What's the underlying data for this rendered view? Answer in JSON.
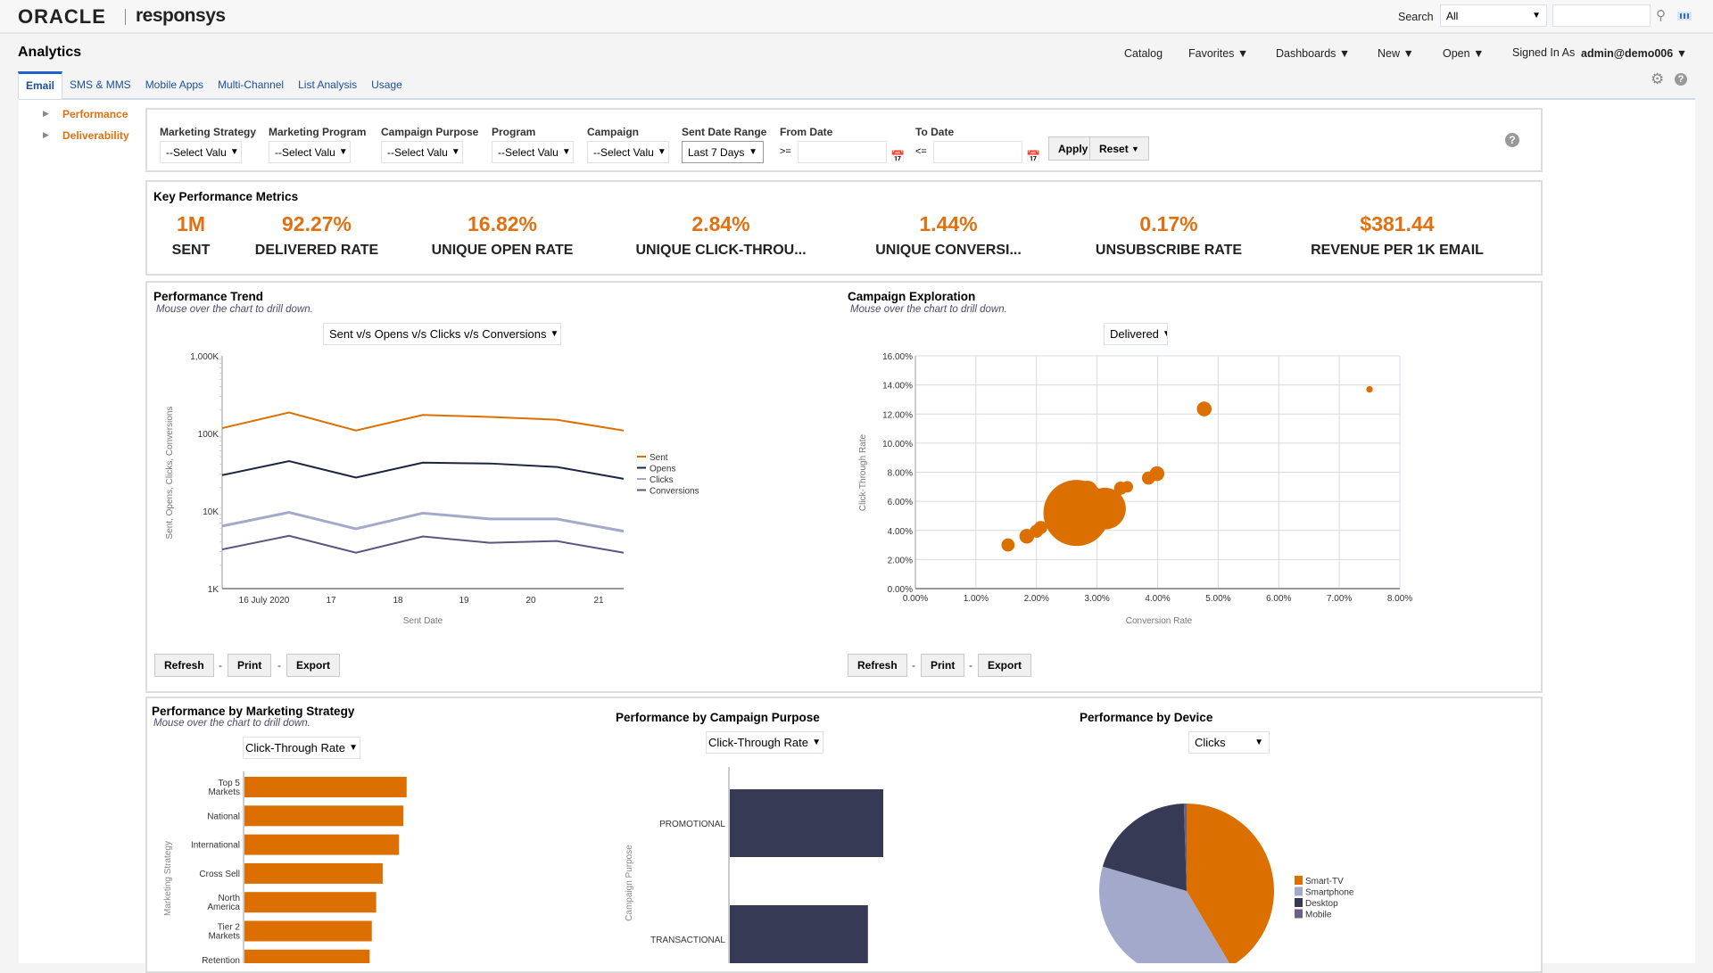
{
  "header": {
    "logo_oracle": "ORACLE",
    "logo_product": "responsys",
    "search_label": "Search",
    "search_scope": "All",
    "search_value": ""
  },
  "nav": {
    "title": "Analytics",
    "catalog": "Catalog",
    "favorites": "Favorites",
    "dashboards": "Dashboards",
    "new": "New",
    "open": "Open",
    "signed_in_label": "Signed In As",
    "user": "admin@demo006"
  },
  "tabs": [
    {
      "label": "Email",
      "active": true
    },
    {
      "label": "SMS & MMS"
    },
    {
      "label": "Mobile Apps"
    },
    {
      "label": "Multi-Channel"
    },
    {
      "label": "List Analysis"
    },
    {
      "label": "Usage"
    }
  ],
  "sidebar": [
    {
      "label": "Performance"
    },
    {
      "label": "Deliverability"
    }
  ],
  "filters": {
    "marketing_strategy": {
      "label": "Marketing Strategy",
      "value": "--Select Valu"
    },
    "marketing_program": {
      "label": "Marketing Program",
      "value": "--Select Valu"
    },
    "campaign_purpose": {
      "label": "Campaign Purpose",
      "value": "--Select Valu"
    },
    "program": {
      "label": "Program",
      "value": "--Select Valu"
    },
    "campaign": {
      "label": "Campaign",
      "value": "--Select Valu"
    },
    "sent_date_range": {
      "label": "Sent Date Range",
      "value": "Last 7 Days"
    },
    "from_date": {
      "label": "From Date",
      "op": ">=",
      "value": ""
    },
    "to_date": {
      "label": "To Date",
      "op": "<=",
      "value": ""
    },
    "apply": "Apply",
    "reset": "Reset"
  },
  "kpi": {
    "title": "Key Performance Metrics",
    "items": [
      {
        "value": "1M",
        "label": "SENT"
      },
      {
        "value": "92.27%",
        "label": "DELIVERED RATE"
      },
      {
        "value": "16.82%",
        "label": "UNIQUE OPEN RATE"
      },
      {
        "value": "2.84%",
        "label": "UNIQUE CLICK-THROU..."
      },
      {
        "value": "1.44%",
        "label": "UNIQUE CONVERSI..."
      },
      {
        "value": "0.17%",
        "label": "UNSUBSCRIBE RATE"
      },
      {
        "value": "$381.44",
        "label": "REVENUE PER 1K EMAIL"
      }
    ]
  },
  "hint": "Mouse over the chart to drill down.",
  "actions": {
    "refresh": "Refresh",
    "print": "Print",
    "export": "Export",
    "sep": "-"
  },
  "colors": {
    "orange": "#db7000",
    "navy": "#363a55",
    "lavender": "#a3a9cb",
    "purple": "#6c5f8a"
  },
  "chart_data": [
    {
      "type": "line",
      "title": "Performance Trend",
      "selector": "Sent v/s Opens v/s Clicks v/s Conversions",
      "xlabel": "Sent Date",
      "ylabel": "Sent, Opens, Clicks, Conversions",
      "yscale": "log",
      "ylim": [
        1000,
        1000000
      ],
      "yticks": [
        "1K",
        "10K",
        "100K",
        "1,000K"
      ],
      "xticks": [
        "16 July 2020",
        "17",
        "18",
        "19",
        "20",
        "21"
      ],
      "legend": "right",
      "series": [
        {
          "name": "Sent",
          "color": "#db7000",
          "values": [
            117000,
            186000,
            109000,
            173000,
            163000,
            150000,
            109000
          ]
        },
        {
          "name": "Opens",
          "color": "#1e2340",
          "values": [
            29000,
            44000,
            27000,
            42000,
            41000,
            37000,
            26000
          ]
        },
        {
          "name": "Clicks",
          "color": "#a3a9cb",
          "values": [
            6400,
            9600,
            5900,
            9400,
            7900,
            7900,
            5500
          ]
        },
        {
          "name": "Conversions",
          "color": "#5e5480",
          "values": [
            3200,
            4800,
            2900,
            4700,
            3900,
            4100,
            2900
          ]
        }
      ]
    },
    {
      "type": "scatter",
      "title": "Campaign Exploration",
      "selector": "Delivered",
      "xlabel": "Conversion Rate",
      "ylabel": "Click-Through Rate",
      "xlim": [
        0,
        8
      ],
      "ylim": [
        0,
        16
      ],
      "xticks": [
        "0.00%",
        "1.00%",
        "2.00%",
        "3.00%",
        "4.00%",
        "5.00%",
        "6.00%",
        "7.00%",
        "8.00%"
      ],
      "yticks": [
        "0.00%",
        "2.00%",
        "4.00%",
        "6.00%",
        "8.00%",
        "10.00%",
        "12.00%",
        "14.00%",
        "16.00%"
      ],
      "grid": true,
      "points": [
        {
          "x": 1.53,
          "y": 3.0,
          "size": 4
        },
        {
          "x": 1.84,
          "y": 3.6,
          "size": 5
        },
        {
          "x": 2.0,
          "y": 3.95,
          "size": 4
        },
        {
          "x": 2.07,
          "y": 4.2,
          "size": 4
        },
        {
          "x": 2.66,
          "y": 5.2,
          "size": 100
        },
        {
          "x": 2.84,
          "y": 6.7,
          "size": 10
        },
        {
          "x": 3.13,
          "y": 5.5,
          "size": 40
        },
        {
          "x": 3.39,
          "y": 6.9,
          "size": 4
        },
        {
          "x": 3.5,
          "y": 7.0,
          "size": 3
        },
        {
          "x": 3.85,
          "y": 7.6,
          "size": 4
        },
        {
          "x": 3.99,
          "y": 7.9,
          "size": 5
        },
        {
          "x": 4.77,
          "y": 12.35,
          "size": 5
        },
        {
          "x": 7.5,
          "y": 13.7,
          "size": 1
        }
      ]
    },
    {
      "type": "bar",
      "orientation": "horizontal",
      "title": "Performance by Marketing Strategy",
      "selector": "Click-Through Rate",
      "ylabel": "Marketing Strategy",
      "categories": [
        "Top 5 Markets",
        "National",
        "International",
        "Cross Sell",
        "North America",
        "Tier 2 Markets",
        "Retention"
      ],
      "values": [
        149,
        146,
        142,
        127,
        121,
        117,
        115
      ]
    },
    {
      "type": "bar",
      "orientation": "horizontal",
      "title": "Performance by Campaign Purpose",
      "selector": "Click-Through Rate",
      "ylabel": "Campaign Purpose",
      "categories": [
        "PROMOTIONAL",
        "TRANSACTIONAL"
      ],
      "values": [
        100,
        90
      ]
    },
    {
      "type": "pie",
      "title": "Performance by Device",
      "selector": "Clicks",
      "legend": "right",
      "slices": [
        {
          "label": "Smart-TV",
          "value": 41.5,
          "color": "#db7000"
        },
        {
          "label": "Smartphone",
          "value": 38,
          "color": "#a3a9cb"
        },
        {
          "label": "Desktop",
          "value": 20,
          "color": "#363a55"
        },
        {
          "label": "Mobile",
          "value": 0.5,
          "color": "#6c5f8a"
        }
      ]
    }
  ]
}
